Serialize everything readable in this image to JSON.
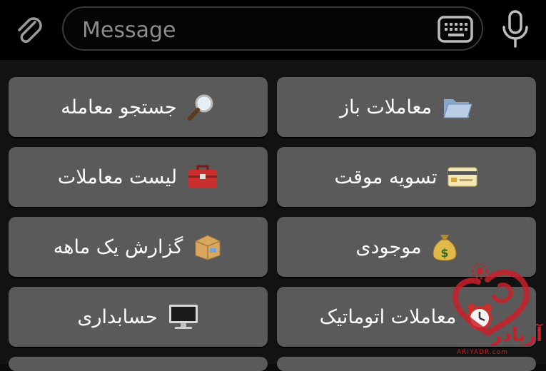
{
  "composer": {
    "placeholder": "Message",
    "attach_icon": "paperclip-icon",
    "keyboard_icon": "keyboard-icon",
    "mic_icon": "microphone-icon"
  },
  "keyboard": {
    "rows": [
      [
        {
          "label": "معاملات باز",
          "icon": "open-folder-icon"
        },
        {
          "label": "جستجو معامله",
          "icon": "magnifier-icon"
        }
      ],
      [
        {
          "label": "تسویه موقت",
          "icon": "credit-card-icon"
        },
        {
          "label": "لیست معاملات",
          "icon": "toolbox-icon"
        }
      ],
      [
        {
          "label": "موجودی",
          "icon": "money-bag-icon"
        },
        {
          "label": "گزارش یک ماهه",
          "icon": "package-icon"
        }
      ],
      [
        {
          "label": "معاملات اتوماتیک",
          "icon": "alarm-clock-icon"
        },
        {
          "label": "حسابداری",
          "icon": "desktop-computer-icon"
        }
      ]
    ]
  },
  "watermark": {
    "brand": "آریادر",
    "site": "ARIYADR.com",
    "color": "#c8202a"
  },
  "colors": {
    "button_bg": "#5a5a5a",
    "panel_bg": "#121212",
    "topbar_bg": "#000000"
  }
}
